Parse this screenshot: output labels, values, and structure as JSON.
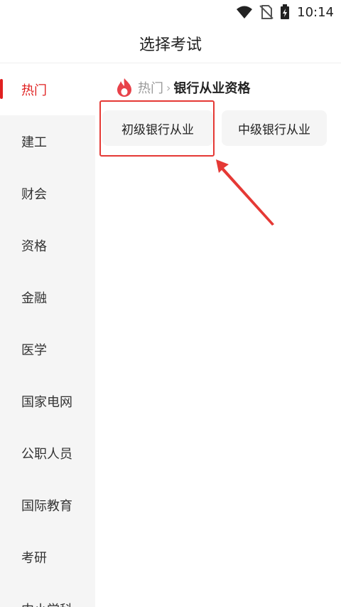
{
  "status_bar": {
    "time": "10:14",
    "icons": [
      "wifi-icon",
      "no-sim-icon",
      "battery-charging-icon"
    ]
  },
  "header": {
    "title": "选择考试"
  },
  "sidebar": {
    "items": [
      {
        "label": "热门",
        "active": true
      },
      {
        "label": "建工",
        "active": false
      },
      {
        "label": "财会",
        "active": false
      },
      {
        "label": "资格",
        "active": false
      },
      {
        "label": "金融",
        "active": false
      },
      {
        "label": "医学",
        "active": false
      },
      {
        "label": "国家电网",
        "active": false
      },
      {
        "label": "公职人员",
        "active": false
      },
      {
        "label": "国际教育",
        "active": false
      },
      {
        "label": "考研",
        "active": false
      },
      {
        "label": "中小学科",
        "active": false
      }
    ]
  },
  "content": {
    "breadcrumb": {
      "icon": "fire-icon",
      "root": "热门",
      "separator": "›",
      "current": "银行从业资格"
    },
    "options": [
      {
        "label": "初级银行从业"
      },
      {
        "label": "中级银行从业"
      }
    ]
  },
  "colors": {
    "accent": "#e02020",
    "annotation": "#e53935",
    "sidebar_bg": "#f5f5f5",
    "chip_bg": "#f5f5f5"
  }
}
